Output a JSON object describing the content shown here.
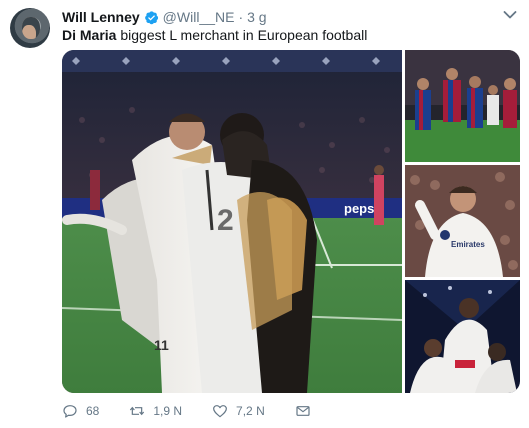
{
  "author": {
    "name": "Will Lenney",
    "handle": "@Will__NE",
    "separator": "·",
    "time": "3 g"
  },
  "tweet": {
    "text_bold": "Di Maria",
    "text_rest": " biggest L merchant in European football"
  },
  "media": {
    "main_ad_text": "pepsi",
    "jersey_number": "11"
  },
  "actions": {
    "replies": "68",
    "retweets": "1,9 N",
    "likes": "7,2 N"
  },
  "colors": {
    "verified": "#1da1f2",
    "text_secondary": "#657786",
    "text_primary": "#14171a"
  }
}
